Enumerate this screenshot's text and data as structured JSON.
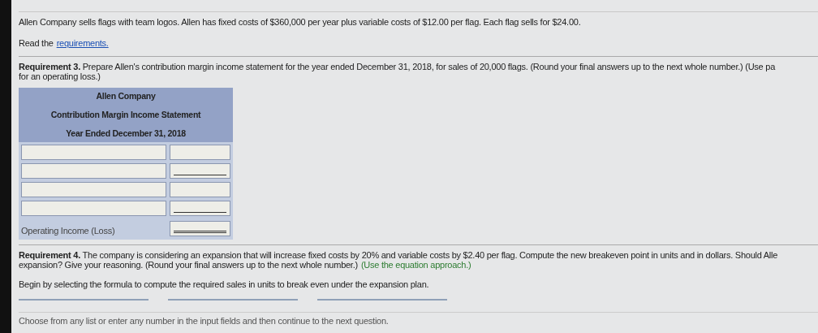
{
  "intro": "Allen Company sells flags with team logos. Allen has fixed costs of $360,000 per year plus variable costs of $12.00 per flag. Each flag sells for $24.00.",
  "read_prefix": "Read the",
  "read_link": "requirements.",
  "requirement3": {
    "lines": [
      "**Requirement 3.** Prepare Allen's contribution margin income statement for the year ended December 31, 2018, for sales of 20,000 flags. (Round your final answers up to the next whole number.) (Use pa",
      "for an operating loss.)"
    ]
  },
  "statement": {
    "header": [
      "Allen Company",
      "Contribution Margin Income Statement",
      "Year Ended December 31, 2018"
    ],
    "rows": [
      {
        "kind": "plain"
      },
      {
        "kind": "subtotal"
      },
      {
        "kind": "plain"
      },
      {
        "kind": "subtotal"
      },
      {
        "kind": "total",
        "label": "Operating Income (Loss)"
      }
    ]
  },
  "requirement4": {
    "lines": [
      "**Requirement 4.** The company is considering an expansion that will increase fixed costs by 20% and variable costs by $2.40 per flag. Compute the new breakeven point in units and in dollars. Should Alle",
      "expansion? Give your reasoning. (Round your final answers up to the next whole number.)"
    ],
    "hint": "(Use the equation approach.)",
    "instruction": "Begin by selecting the formula to compute the required sales in units to break even under the expansion plan.",
    "formula_blanks": [
      {
        "kind": "dropdown"
      },
      {
        "kind": "dropdown"
      },
      {
        "kind": "dropdown"
      }
    ]
  },
  "footer": "Choose from any list or enter any number in the input fields and then continue to the next question."
}
